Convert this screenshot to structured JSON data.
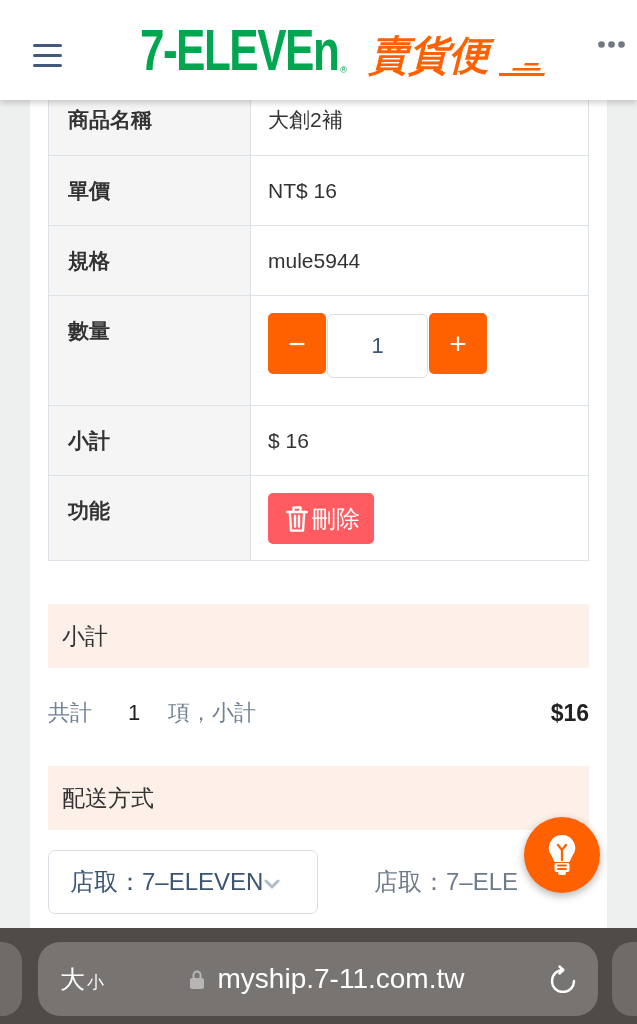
{
  "header": {
    "brand": "7-ELEVEn",
    "registered": "®",
    "service": "賣貨便"
  },
  "item_table": {
    "rows": [
      {
        "kind": "text",
        "label": "商品名稱",
        "value": "大創2補"
      },
      {
        "kind": "text",
        "label": "單價",
        "value": "NT$ 16"
      },
      {
        "kind": "text",
        "label": "規格",
        "value": "mule5944"
      },
      {
        "kind": "quantity",
        "label": "數量",
        "decrement": "−",
        "quantity": "1",
        "increment": "+"
      },
      {
        "kind": "text",
        "label": "小計",
        "value": "$ 16"
      },
      {
        "kind": "actions",
        "label": "功能",
        "button": "刪除"
      }
    ]
  },
  "subtotal_section": {
    "title": "小計",
    "count_prefix": "共計",
    "count": "1",
    "count_suffix": "項，小計",
    "amount": "$16"
  },
  "shipping_section": {
    "title": "配送方式",
    "method_select": {
      "value": "店取：7–ELEVEN"
    },
    "method_display": "店取：7–ELE"
  },
  "browser_bar": {
    "text_size_large": "大",
    "text_size_small": "小",
    "url": "myship.7-11.com.tw"
  }
}
